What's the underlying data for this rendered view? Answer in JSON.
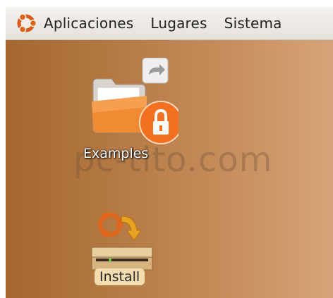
{
  "top_panel": {
    "menu_items": [
      {
        "label": "Aplicaciones"
      },
      {
        "label": "Lugares"
      },
      {
        "label": "Sistema"
      }
    ]
  },
  "desktop": {
    "icons": [
      {
        "label": "Examples",
        "icon": "folder-icon",
        "emblems": [
          "symlink-arrow-icon",
          "lock-emblem-icon"
        ]
      },
      {
        "label": "Install",
        "icon": "install-drive-icon"
      }
    ],
    "watermark": "pc-tito.com"
  },
  "colors": {
    "desktop_start": "#a5672f",
    "desktop_end": "#d6a47a",
    "ubuntu_orange": "#e0661c"
  }
}
